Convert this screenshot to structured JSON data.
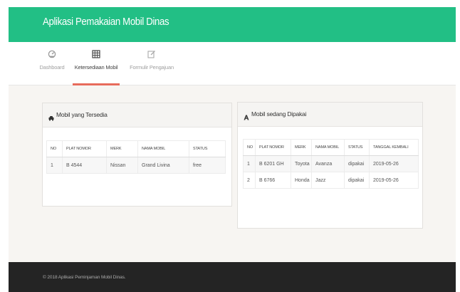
{
  "header": {
    "title": "Aplikasi Pemakaian Mobil Dinas"
  },
  "nav": {
    "items": [
      {
        "label": "Dashboard",
        "icon": "dashboard-icon"
      },
      {
        "label": "Ketersediaan Mobil",
        "icon": "table-icon",
        "active": true
      },
      {
        "label": "Formulir Pengajuan",
        "icon": "edit-icon"
      }
    ],
    "active_color": "#e76b5c"
  },
  "available": {
    "title": "Mobil yang Tersedia",
    "icon": "car-icon",
    "columns": [
      "NO",
      "PLAT NOMOR",
      "MERK",
      "NAMA MOBIL",
      "STATUS"
    ],
    "rows": [
      [
        "1",
        "B 4544",
        "Nissan",
        "Grand Livina",
        "free"
      ]
    ]
  },
  "in_use": {
    "title": "Mobil sedang Dipakai",
    "icon": "font-a-icon",
    "columns": [
      "NO",
      "PLAT NOMOR",
      "MERK",
      "NAMA MOBIL",
      "STATUS",
      "TANGGAL KEMBALI"
    ],
    "rows": [
      [
        "1",
        "B 6201 GH",
        "Toyota",
        "Avanza",
        "dipakai",
        "2019-05-26"
      ],
      [
        "2",
        "B 6766",
        "Honda",
        "Jazz",
        "dipakai",
        "2019-05-26"
      ]
    ]
  },
  "footer": {
    "text": "© 2018 Aplikasi Peminjaman Mobil Dinas."
  },
  "colors": {
    "header": "#22bf85",
    "footer": "#242424",
    "background": "#f7f5f2"
  }
}
